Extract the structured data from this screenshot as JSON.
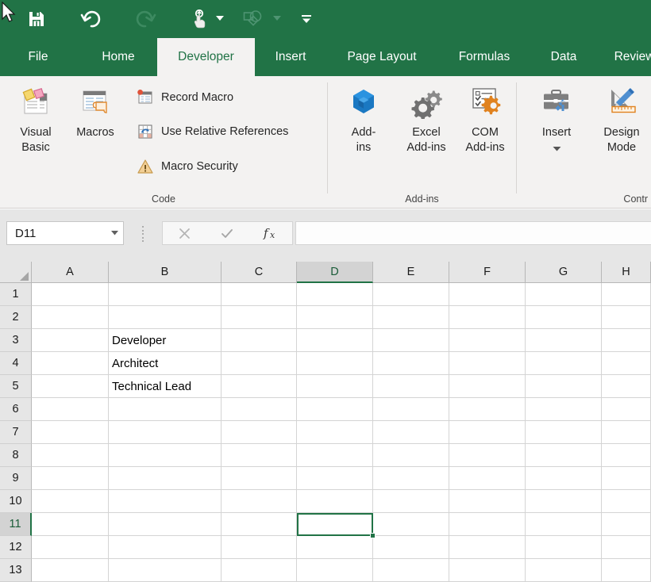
{
  "app": {
    "accent_green": "#217346",
    "ribbon_bg": "#f3f2f1"
  },
  "quick_access": {
    "items": [
      {
        "name": "save-icon",
        "label": "Save"
      },
      {
        "name": "undo-icon",
        "label": "Undo"
      },
      {
        "name": "redo-icon",
        "label": "Redo"
      },
      {
        "name": "touch-mode-icon",
        "label": "Touch/Mouse Mode"
      },
      {
        "name": "customize-shapes-icon",
        "label": "Customize Quick Access Toolbar"
      },
      {
        "name": "more-options-icon",
        "label": "More"
      }
    ]
  },
  "tabs": [
    {
      "label": "File",
      "active": false
    },
    {
      "label": "Home",
      "active": false
    },
    {
      "label": "Developer",
      "active": true
    },
    {
      "label": "Insert",
      "active": false
    },
    {
      "label": "Page Layout",
      "active": false
    },
    {
      "label": "Formulas",
      "active": false
    },
    {
      "label": "Data",
      "active": false
    },
    {
      "label": "Review",
      "active": false
    }
  ],
  "ribbon": {
    "groups": [
      {
        "label": "Code"
      },
      {
        "label": "Add-ins"
      },
      {
        "label": "Contr"
      }
    ],
    "code": {
      "visual_basic": "Visual\nBasic",
      "macros": "Macros",
      "record_macro": "Record Macro",
      "use_relative_references": "Use Relative References",
      "macro_security": "Macro Security"
    },
    "addins": {
      "addins": "Add-\nins",
      "excel_addins": "Excel\nAdd-ins",
      "com_addins": "COM\nAdd-ins"
    },
    "controls": {
      "insert": "Insert",
      "design_mode": "Design\nMode"
    }
  },
  "formula_bar": {
    "name_box_value": "D11",
    "formula_value": "",
    "cancel_label": "Cancel",
    "enter_label": "Enter",
    "fx_label": "Insert Function"
  },
  "grid": {
    "columns": [
      "A",
      "B",
      "C",
      "D",
      "E",
      "F",
      "G",
      "H"
    ],
    "rows": [
      "1",
      "2",
      "3",
      "4",
      "5",
      "6",
      "7",
      "8",
      "9",
      "10",
      "11",
      "12",
      "13"
    ],
    "selected_cell": "D11",
    "selected_column": "D",
    "selected_row": "11",
    "cells": [
      {
        "col": "B",
        "row": "3",
        "value": "Developer"
      },
      {
        "col": "B",
        "row": "4",
        "value": "Architect"
      },
      {
        "col": "B",
        "row": "5",
        "value": "Technical Lead"
      }
    ]
  }
}
